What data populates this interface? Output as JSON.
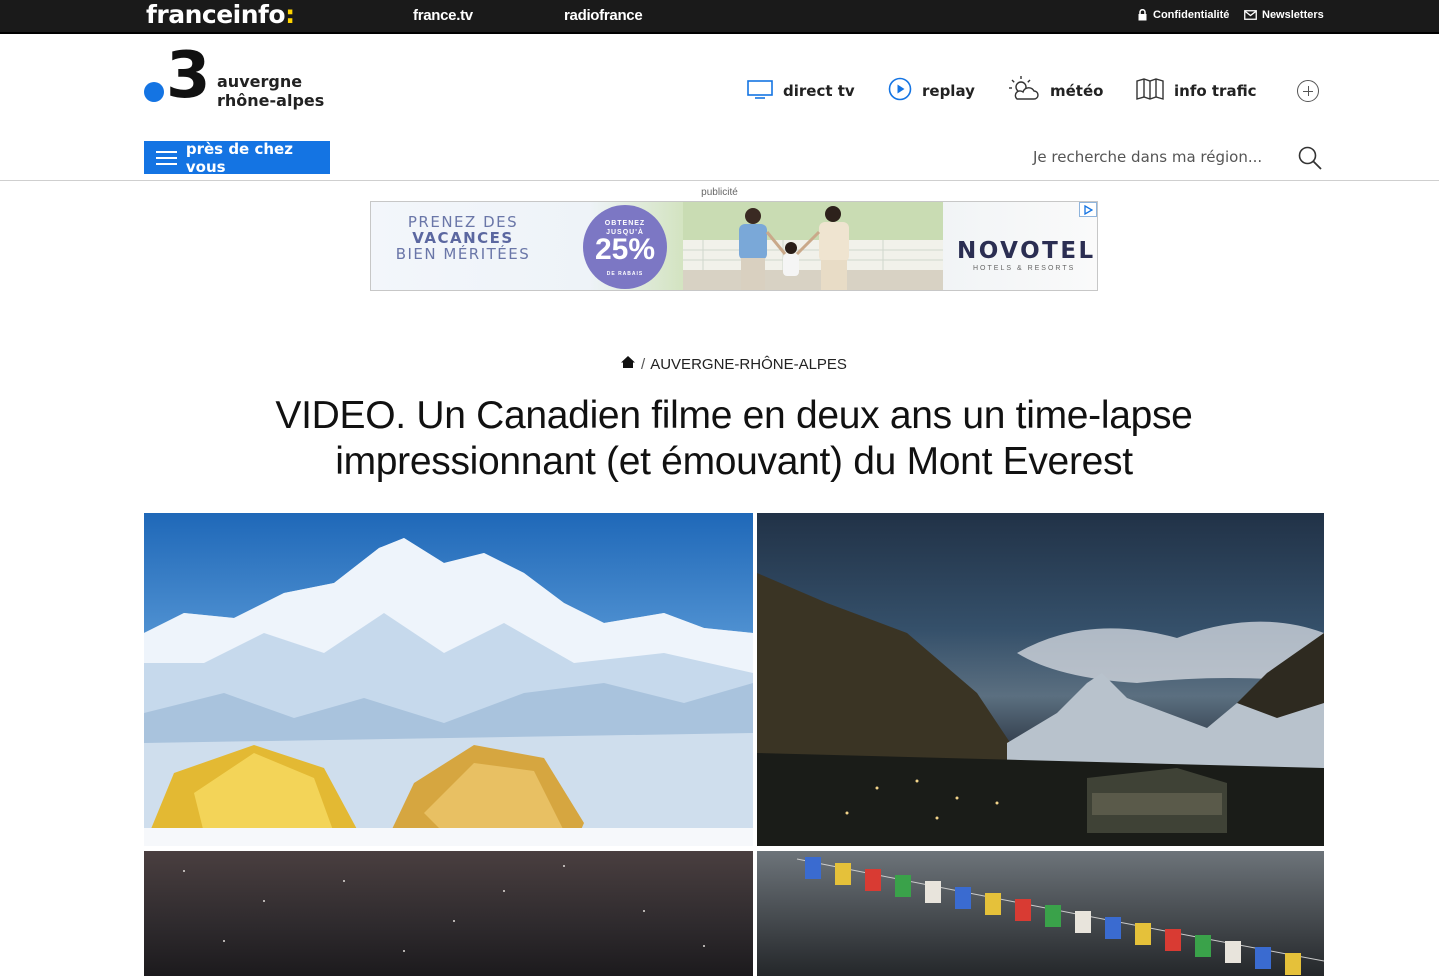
{
  "topbar": {
    "brand": "franceinfo",
    "brand_colon": ":",
    "links": [
      "france.tv",
      "radiofrance"
    ],
    "privacy_label": "Confidentialité",
    "newsletters_label": "Newsletters"
  },
  "header": {
    "logo_number": "3",
    "region_line1": "auvergne",
    "region_line2": "rhône-alpes",
    "nav": {
      "direct_tv": "direct tv",
      "replay": "replay",
      "meteo": "météo",
      "info_trafic": "info trafic"
    },
    "pres_button": "près de chez vous",
    "search_placeholder": "Je recherche dans ma région..."
  },
  "ad": {
    "label": "publicité",
    "line1": "PRENEZ DES",
    "line2": "VACANCES",
    "line3": "BIEN MÉRITÉES",
    "badge_top1": "OBTENEZ",
    "badge_top2": "JUSQU'À",
    "badge_value": "25%",
    "badge_bottom": "DE RABAIS",
    "brand": "NOVOTEL",
    "brand_sub": "HOTELS & RESORTS"
  },
  "article": {
    "breadcrumb_section": "AUVERGNE-RHÔNE-ALPES",
    "breadcrumb_sep": "/",
    "title_line1": "VIDEO. Un Canadien filme en deux ans un time-lapse",
    "title_line2": "impressionnant (et émouvant) du Mont Everest"
  },
  "colors": {
    "topbar_bg": "#1a1a1a",
    "brand_accent": "#ffd400",
    "primary_blue": "#1474e3",
    "ad_badge": "#7c77c4",
    "ad_text": "#6a76a8"
  },
  "icons": {
    "privacy": "lock-icon",
    "newsletters": "envelope-icon",
    "direct_tv": "tv-screen-icon",
    "replay": "play-circle-icon",
    "meteo": "sun-cloud-icon",
    "info_trafic": "map-icon",
    "more": "plus-circle-icon",
    "menu": "hamburger-icon",
    "search": "search-icon",
    "home": "home-icon",
    "ad_choices": "adchoices-icon"
  }
}
